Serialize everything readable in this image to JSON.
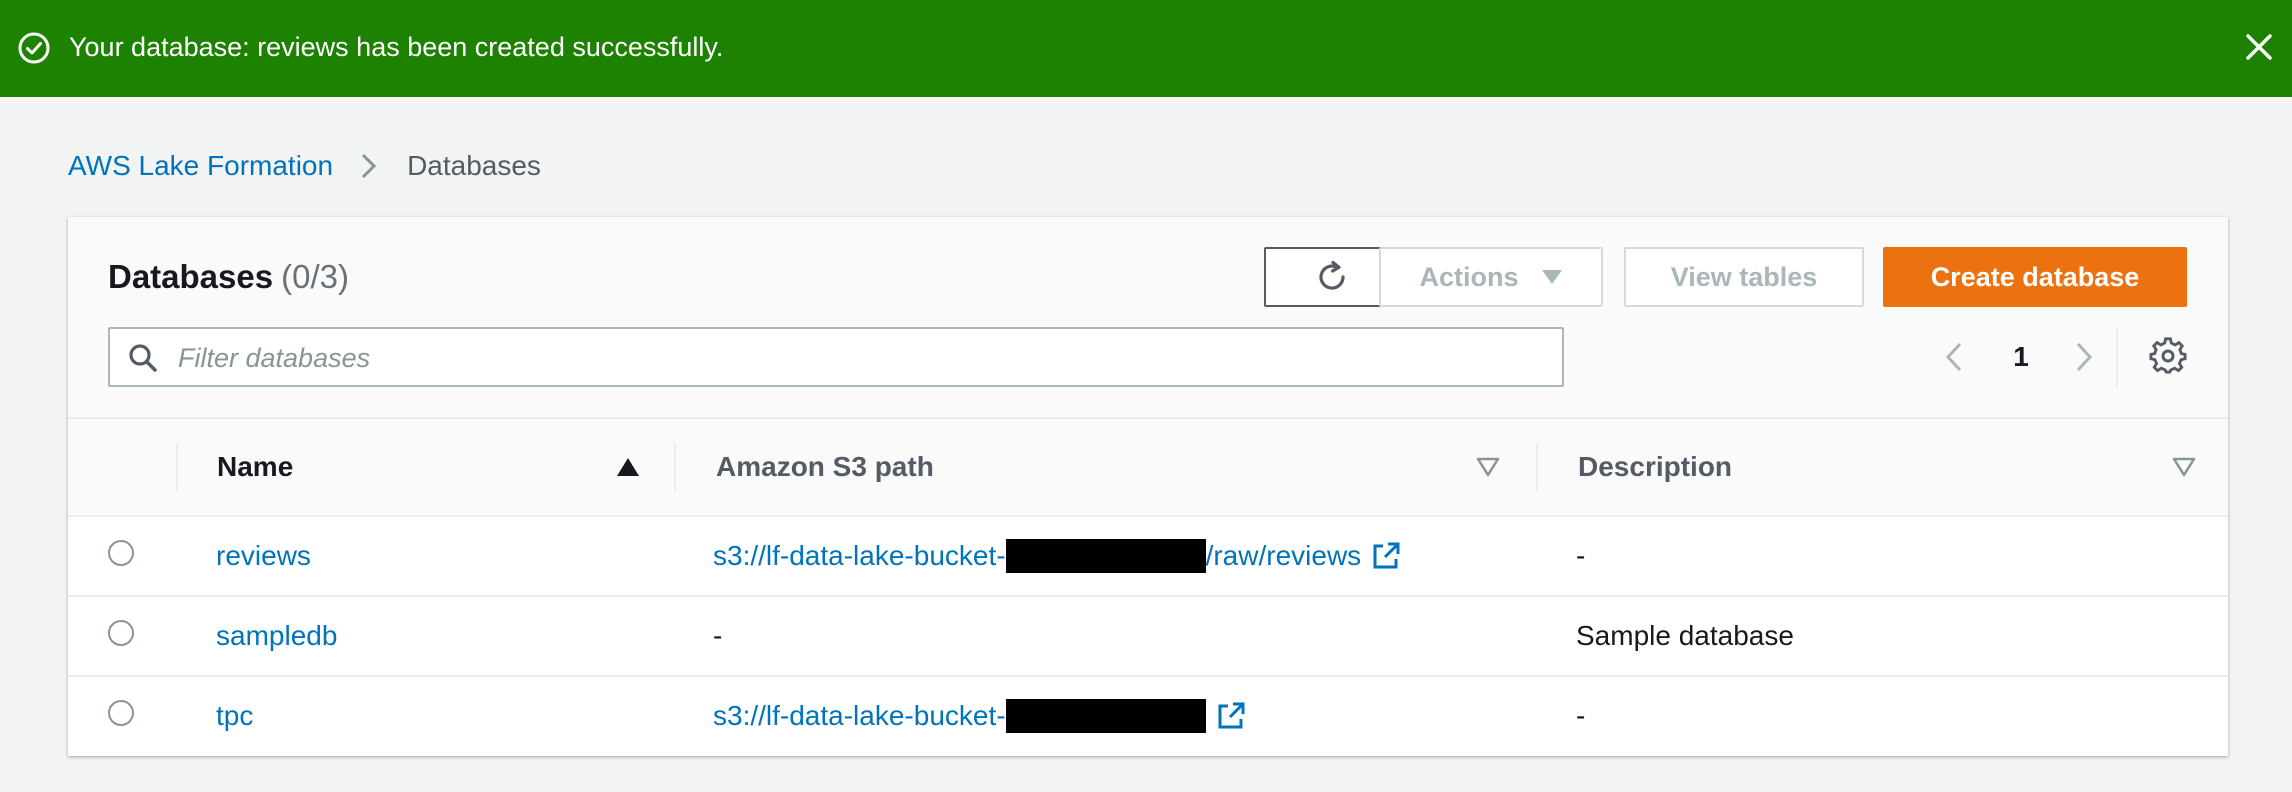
{
  "flash": {
    "message": "Your database: reviews has been created successfully."
  },
  "breadcrumb": {
    "root": "AWS Lake Formation",
    "current": "Databases"
  },
  "panel": {
    "title": "Databases",
    "count": "(0/3)",
    "buttons": {
      "actions": "Actions",
      "view_tables": "View tables",
      "create": "Create database"
    },
    "filter_placeholder": "Filter databases",
    "page": "1"
  },
  "table": {
    "headers": {
      "name": "Name",
      "path": "Amazon S3 path",
      "description": "Description"
    },
    "rows": [
      {
        "name": "reviews",
        "path_prefix": "s3://lf-data-lake-bucket-",
        "path_suffix": "/raw/reviews",
        "description": "-"
      },
      {
        "name": "sampledb",
        "path_prefix": "-",
        "path_suffix": "",
        "description": "Sample database"
      },
      {
        "name": "tpc",
        "path_prefix": "s3://lf-data-lake-bucket-",
        "path_suffix": "",
        "description": "-"
      }
    ]
  },
  "colors": {
    "success": "#1d8102",
    "primary": "#ec7211",
    "link": "#0073bb"
  }
}
